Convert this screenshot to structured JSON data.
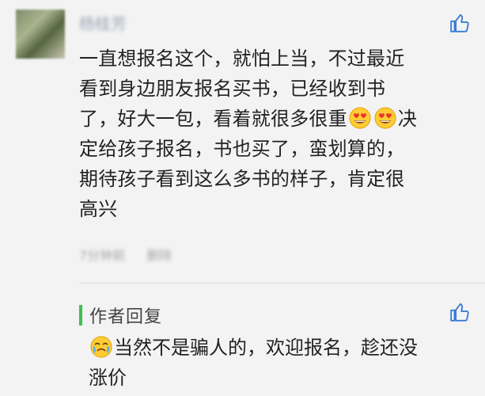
{
  "comment": {
    "username": "杨桂芳",
    "lines": [
      "一直想报名这个，就怕上当，不过最近",
      "看到身边朋友报名买书，已经收到书",
      "了，好大一包，看着就很多很重",
      "决",
      "定给孩子报名，书也买了，蛮划算的，",
      "期待孩子看到这么多书的样子，肯定很",
      "高兴"
    ],
    "emoji_icons": [
      "heart-eyes-emoji",
      "heart-eyes-emoji"
    ],
    "time": "7分钟前",
    "delete_label": "删除"
  },
  "reply": {
    "title": "作者回复",
    "emoji_icon": "crying-face-emoji",
    "lines": [
      "当然不是骗人的，欢迎报名，趁还没",
      "涨价"
    ]
  },
  "colors": {
    "background": "#f3f3f3",
    "accent_bar": "#3fbf4e",
    "icon_blue": "#3a7bd5",
    "text": "#222222"
  }
}
